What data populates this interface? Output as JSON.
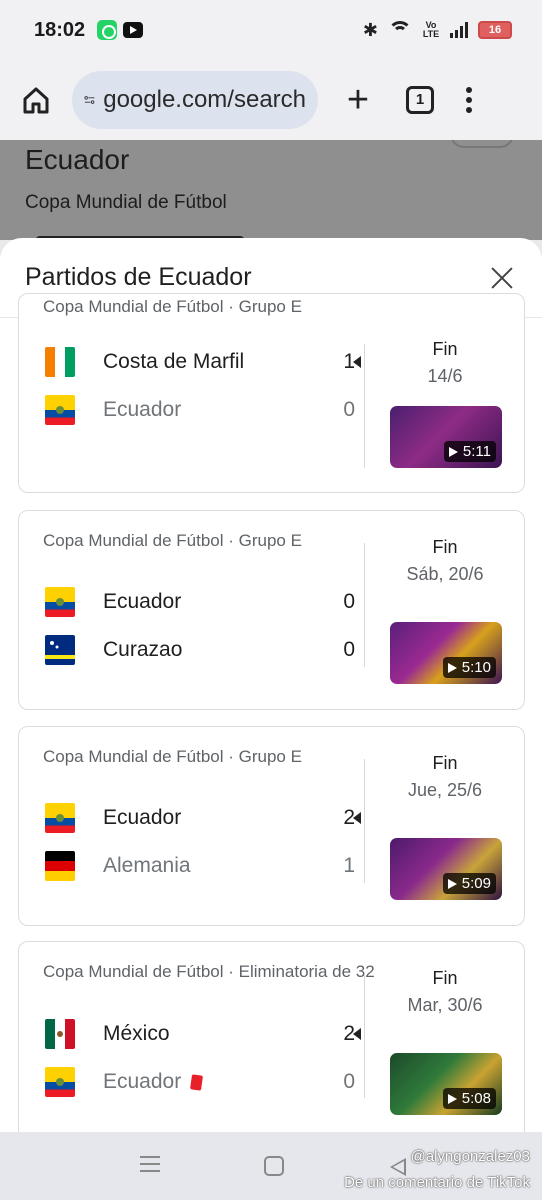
{
  "status_bar": {
    "time": "18:02",
    "battery": "16",
    "network": "Vo LTE"
  },
  "browser": {
    "url": "google.com/search",
    "tab_count": "1"
  },
  "background_page": {
    "title": "Ecuador",
    "subtitle": "Copa Mundial de Fútbol"
  },
  "sheet": {
    "title": "Partidos de Ecuador"
  },
  "matches": [
    {
      "meta": "Copa Mundial de Fútbol · Grupo E",
      "team1": {
        "name": "Costa de Marfil",
        "score": "1",
        "flag": "civ-flag-icon"
      },
      "team2": {
        "name": "Ecuador",
        "score": "0",
        "flag": "ecuador-flag-icon"
      },
      "status": "Fin",
      "date": "14/6",
      "duration": "5:11",
      "winner": 1
    },
    {
      "meta": "Copa Mundial de Fútbol · Grupo E",
      "team1": {
        "name": "Ecuador",
        "score": "0",
        "flag": "ecuador-flag-icon"
      },
      "team2": {
        "name": "Curazao",
        "score": "0",
        "flag": "curacao-flag-icon"
      },
      "status": "Fin",
      "date": "Sáb, 20/6",
      "duration": "5:10",
      "winner": 0
    },
    {
      "meta": "Copa Mundial de Fútbol · Grupo E",
      "team1": {
        "name": "Ecuador",
        "score": "2",
        "flag": "ecuador-flag-icon"
      },
      "team2": {
        "name": "Alemania",
        "score": "1",
        "flag": "germany-flag-icon"
      },
      "status": "Fin",
      "date": "Jue, 25/6",
      "duration": "5:09",
      "winner": 1
    },
    {
      "meta": "Copa Mundial de Fútbol · Eliminatoria de 32",
      "team1": {
        "name": "México",
        "score": "2",
        "flag": "mexico-flag-icon"
      },
      "team2": {
        "name": "Ecuador",
        "score": "0",
        "flag": "ecuador-flag-icon",
        "red_card": true
      },
      "status": "Fin",
      "date": "Mar, 30/6",
      "duration": "5:08",
      "winner": 1
    }
  ],
  "watermark": {
    "user": "@alyngonzalez03",
    "text": "De un comentario de TikTok"
  }
}
